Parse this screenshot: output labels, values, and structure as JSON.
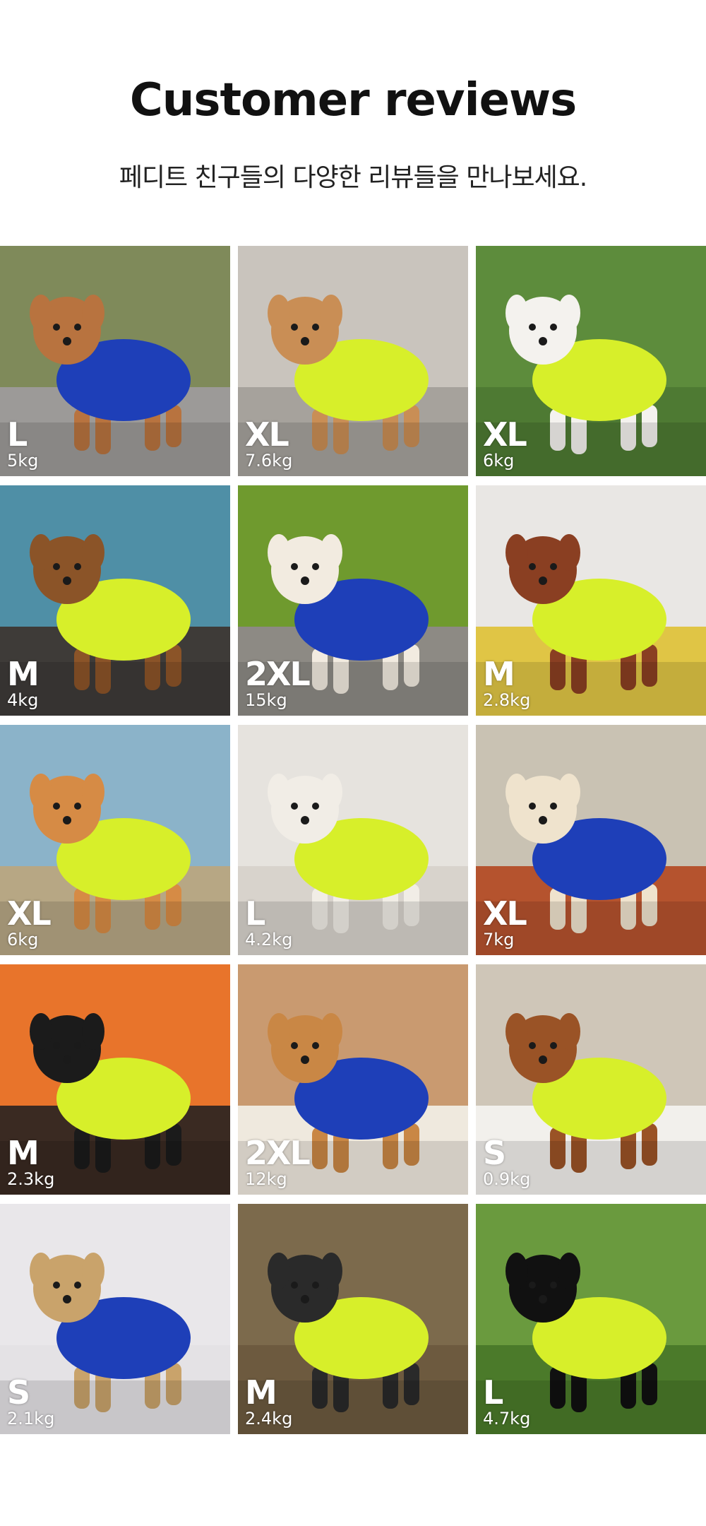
{
  "header": {
    "title": "Customer reviews",
    "subtitle": "페디트 친구들의 다양한 리뷰들을 만나보세요."
  },
  "colors": {
    "blue_shirt": "#1e3fb8",
    "lime_shirt": "#d7ef2a"
  },
  "reviews": [
    {
      "size": "L",
      "weight": "5kg",
      "shirt": "blue",
      "bg": "#7f8a5a",
      "floor": "#9c9a98",
      "dog": "#b8733f"
    },
    {
      "size": "XL",
      "weight": "7.6kg",
      "shirt": "lime",
      "bg": "#c9c4bd",
      "floor": "#a6a29c",
      "dog": "#c98e55"
    },
    {
      "size": "XL",
      "weight": "6kg",
      "shirt": "lime",
      "bg": "#5d8c3c",
      "floor": "#4e7a33",
      "dog": "#f4f2ee"
    },
    {
      "size": "M",
      "weight": "4kg",
      "shirt": "lime",
      "bg": "#4f8fa6",
      "floor": "#3e3b38",
      "dog": "#8b5428"
    },
    {
      "size": "2XL",
      "weight": "15kg",
      "shirt": "blue",
      "bg": "#6f9a2e",
      "floor": "#8d8a84",
      "dog": "#f2ebe0"
    },
    {
      "size": "M",
      "weight": "2.8kg",
      "shirt": "lime",
      "bg": "#e9e7e4",
      "floor": "#e0c545",
      "dog": "#8a3f22"
    },
    {
      "size": "XL",
      "weight": "6kg",
      "shirt": "lime",
      "bg": "#8bb3c9",
      "floor": "#b7a784",
      "dog": "#d68b45"
    },
    {
      "size": "L",
      "weight": "4.2kg",
      "shirt": "lime",
      "bg": "#e6e3de",
      "floor": "#d8d3cc",
      "dog": "#f1ede6"
    },
    {
      "size": "XL",
      "weight": "7kg",
      "shirt": "blue",
      "bg": "#c9c2b3",
      "floor": "#b5532e",
      "dog": "#efe3cd"
    },
    {
      "size": "M",
      "weight": "2.3kg",
      "shirt": "lime",
      "bg": "#e8742b",
      "floor": "#3a2a22",
      "dog": "#1b1b1b"
    },
    {
      "size": "2XL",
      "weight": "12kg",
      "shirt": "blue",
      "bg": "#c99a70",
      "floor": "#efe9de",
      "dog": "#c98745"
    },
    {
      "size": "S",
      "weight": "0.9kg",
      "shirt": "lime",
      "bg": "#cfc6b8",
      "floor": "#f2f0ec",
      "dog": "#9a5326"
    },
    {
      "size": "S",
      "weight": "2.1kg",
      "shirt": "blue",
      "bg": "#e9e7ea",
      "floor": "#e4e2e5",
      "dog": "#c9a36b"
    },
    {
      "size": "M",
      "weight": "2.4kg",
      "shirt": "lime",
      "bg": "#7c6a4c",
      "floor": "#6d5a3f",
      "dog": "#2a2a2a"
    },
    {
      "size": "L",
      "weight": "4.7kg",
      "shirt": "lime",
      "bg": "#6a9a3e",
      "floor": "#4b7a2a",
      "dog": "#111111"
    }
  ]
}
